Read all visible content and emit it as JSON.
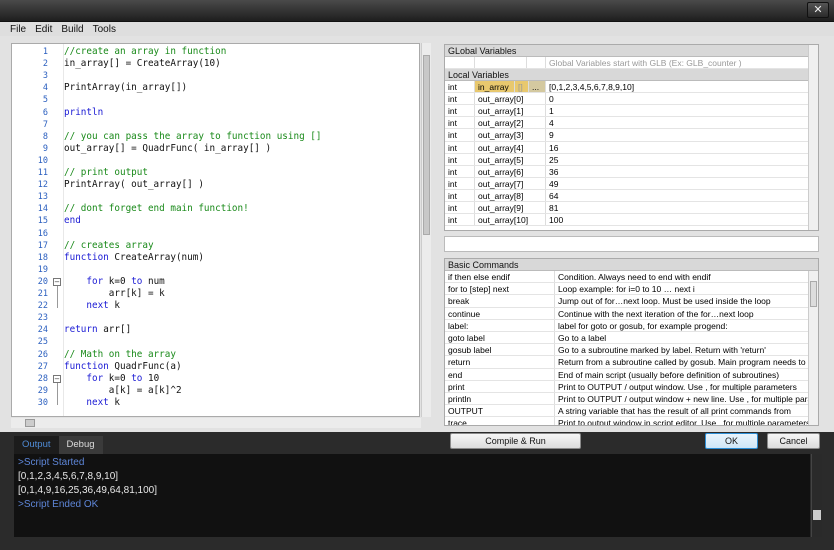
{
  "window": {
    "close_label": "✕"
  },
  "menu": {
    "items": [
      "File",
      "Edit",
      "Build",
      "Tools"
    ]
  },
  "editor": {
    "lines": [
      [
        {
          "t": "//create an array in function",
          "c": "c"
        }
      ],
      [
        {
          "t": "in_array[] = CreateArray(10)",
          "c": "n"
        }
      ],
      [],
      [
        {
          "t": "PrintArray(in_array[])",
          "c": "n"
        }
      ],
      [],
      [
        {
          "t": "println",
          "c": "k"
        }
      ],
      [],
      [
        {
          "t": "// you can pass the array to function using []",
          "c": "c"
        }
      ],
      [
        {
          "t": "out_array[] = QuadrFunc( in_array[] )",
          "c": "n"
        }
      ],
      [],
      [
        {
          "t": "// print output",
          "c": "c"
        }
      ],
      [
        {
          "t": "PrintArray( out_array[] )",
          "c": "n"
        }
      ],
      [],
      [
        {
          "t": "// dont forget end main function!",
          "c": "c"
        }
      ],
      [
        {
          "t": "end",
          "c": "k"
        }
      ],
      [],
      [
        {
          "t": "// creates array",
          "c": "c"
        }
      ],
      [
        {
          "t": "function",
          "c": "k"
        },
        {
          "t": " CreateArray(num)",
          "c": "n"
        }
      ],
      [],
      [
        {
          "t": "    ",
          "c": "n"
        },
        {
          "t": "for",
          "c": "k"
        },
        {
          "t": " k=0 ",
          "c": "n"
        },
        {
          "t": "to",
          "c": "k"
        },
        {
          "t": " num",
          "c": "n"
        }
      ],
      [
        {
          "t": "        arr[k] = k",
          "c": "n"
        }
      ],
      [
        {
          "t": "    ",
          "c": "n"
        },
        {
          "t": "next",
          "c": "k"
        },
        {
          "t": " k",
          "c": "n"
        }
      ],
      [],
      [
        {
          "t": "return",
          "c": "k"
        },
        {
          "t": " arr[]",
          "c": "n"
        }
      ],
      [],
      [
        {
          "t": "// Math on the array",
          "c": "c"
        }
      ],
      [
        {
          "t": "function",
          "c": "k"
        },
        {
          "t": " QuadrFunc(a)",
          "c": "n"
        }
      ],
      [
        {
          "t": "    ",
          "c": "n"
        },
        {
          "t": "for",
          "c": "k"
        },
        {
          "t": " k=0 ",
          "c": "n"
        },
        {
          "t": "to",
          "c": "k"
        },
        {
          "t": " 10",
          "c": "n"
        }
      ],
      [
        {
          "t": "        a[k] = a[k]^2",
          "c": "n"
        }
      ],
      [
        {
          "t": "    ",
          "c": "n"
        },
        {
          "t": "next",
          "c": "k"
        },
        {
          "t": " k",
          "c": "n"
        }
      ]
    ],
    "line_numbers": [
      "1",
      "2",
      "3",
      "4",
      "5",
      "6",
      "7",
      "8",
      "9",
      "10",
      "11",
      "12",
      "13",
      "14",
      "15",
      "16",
      "17",
      "18",
      "19",
      "20",
      "21",
      "22",
      "23",
      "24",
      "25",
      "26",
      "27",
      "28",
      "29",
      "30"
    ]
  },
  "globals": {
    "header": "GLobal Variables",
    "hint": "Global Variables start with GLB  (Ex: GLB_counter )",
    "local_header": "Local Variables",
    "rows": [
      {
        "type": "int",
        "name": "in_array",
        "b1": "[]",
        "b2": "...",
        "value": "[0,1,2,3,4,5,6,7,8,9,10]"
      },
      {
        "type": "int",
        "name": "out_array[0]",
        "value": "0"
      },
      {
        "type": "int",
        "name": "out_array[1]",
        "value": "1"
      },
      {
        "type": "int",
        "name": "out_array[2]",
        "value": "4"
      },
      {
        "type": "int",
        "name": "out_array[3]",
        "value": "9"
      },
      {
        "type": "int",
        "name": "out_array[4]",
        "value": "16"
      },
      {
        "type": "int",
        "name": "out_array[5]",
        "value": "25"
      },
      {
        "type": "int",
        "name": "out_array[6]",
        "value": "36"
      },
      {
        "type": "int",
        "name": "out_array[7]",
        "value": "49"
      },
      {
        "type": "int",
        "name": "out_array[8]",
        "value": "64"
      },
      {
        "type": "int",
        "name": "out_array[9]",
        "value": "81"
      },
      {
        "type": "int",
        "name": "out_array[10]",
        "value": "100"
      }
    ]
  },
  "commands": {
    "header": "Basic Commands",
    "rows": [
      [
        "if then else endif",
        "Condition. Always need to end with endif"
      ],
      [
        "for to [step] next",
        "Loop example: for i=0 to 10 … next i"
      ],
      [
        "break",
        "Jump out of for…next loop. Must be used inside the loop"
      ],
      [
        "continue",
        "Continue with the next iteration of the for…next loop"
      ],
      [
        "label:",
        "label for goto or gosub, for example progend:"
      ],
      [
        "goto label",
        "Go to a label"
      ],
      [
        "gosub label",
        "Go to a subroutine marked by label. Return with 'return'"
      ],
      [
        "return",
        "Return from a subroutine called by gosub. Main program needs to have"
      ],
      [
        "end",
        "End of main script (usually before definition of subroutines)"
      ],
      [
        "print",
        "Print to OUTPUT / output window. Use , for multiple parameters"
      ],
      [
        "println",
        "Print to OUTPUT / output window + new line. Use , for multiple parame"
      ],
      [
        "OUTPUT",
        "A string variable that has the result of all print commands from"
      ],
      [
        "trace",
        "Print to output window in script editor. Use , for multiple parameters"
      ]
    ]
  },
  "buttons": {
    "compile": "Compile & Run",
    "ok": "OK",
    "cancel": "Cancel"
  },
  "output": {
    "tabs": [
      "Output",
      "Debug"
    ],
    "lines": [
      {
        "t": ">Script Started",
        "c": "blue"
      },
      {
        "t": "[0,1,2,3,4,5,6,7,8,9,10]",
        "c": "white"
      },
      {
        "t": "[0,1,4,9,16,25,36,49,64,81,100]",
        "c": "white"
      },
      {
        "t": ">Script Ended OK",
        "c": "blue"
      }
    ]
  },
  "colors": {
    "comment": "#1a8a1a",
    "keyword": "#1a1ad4",
    "line_number": "#2b5fbf",
    "selection": "#e8c86e",
    "output_blue": "#5e86d8"
  }
}
